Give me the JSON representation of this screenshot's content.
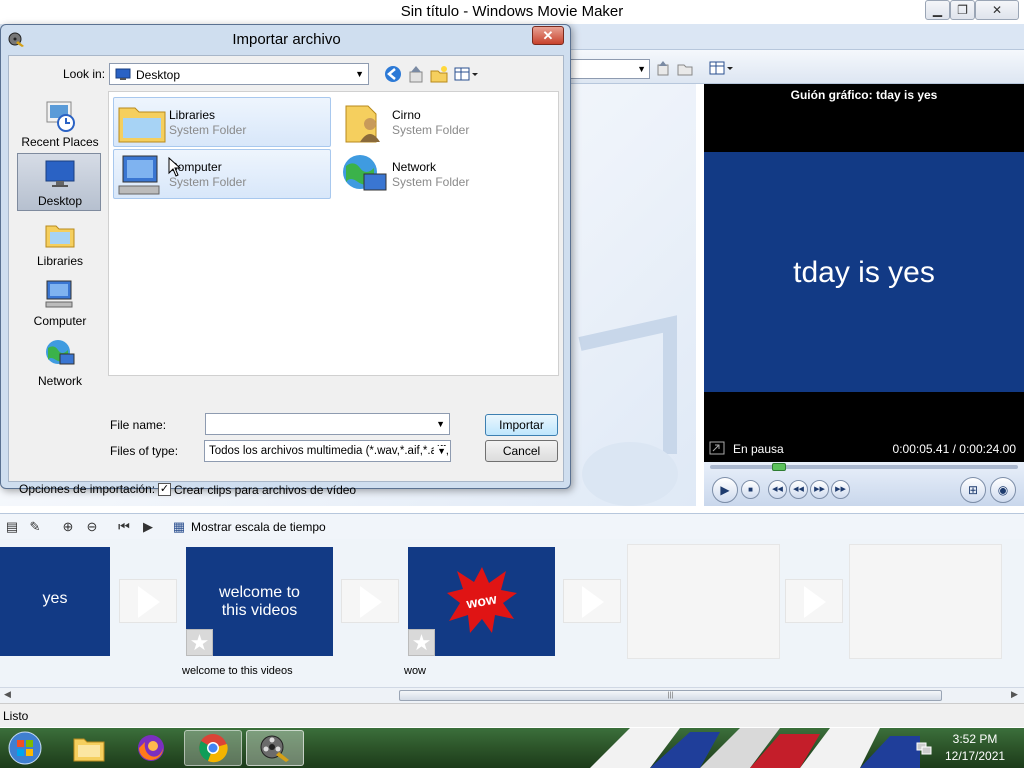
{
  "app": {
    "title": "Sin título - Windows Movie Maker",
    "window_buttons": [
      "minimize",
      "restore",
      "close"
    ]
  },
  "monitor": {
    "title": "Guión gráfico: tday is yes",
    "screen_text": "tday is yes",
    "status": "En pausa",
    "time": "0:00:05.41 / 0:00:24.00",
    "seek_fraction": 0.225
  },
  "timeline": {
    "toggle_label": "Mostrar escala de tiempo",
    "clips": [
      {
        "text": "yes",
        "caption": ""
      },
      {
        "text": "welcome to this videos",
        "caption": "welcome to this videos"
      },
      {
        "text": "wow",
        "caption": "wow"
      }
    ]
  },
  "status_bar": {
    "text": "Listo"
  },
  "dialog": {
    "title": "Importar archivo",
    "look_in_label": "Look in:",
    "look_in_value": "Desktop",
    "places": [
      {
        "label": "Recent Places",
        "icon": "recent-places-icon"
      },
      {
        "label": "Desktop",
        "icon": "desktop-icon",
        "selected": true
      },
      {
        "label": "Libraries",
        "icon": "libraries-icon"
      },
      {
        "label": "Computer",
        "icon": "computer-icon"
      },
      {
        "label": "Network",
        "icon": "network-icon"
      }
    ],
    "files": [
      {
        "name": "Libraries",
        "type": "System Folder"
      },
      {
        "name": "Cirno",
        "type": "System Folder"
      },
      {
        "name": "Computer",
        "type": "System Folder"
      },
      {
        "name": "Network",
        "type": "System Folder"
      }
    ],
    "file_name_label": "File name:",
    "file_name_value": "",
    "files_of_type_label": "Files of type:",
    "files_of_type_value": "Todos los archivos multimedia (*.wav,*.aif,*.aiff,",
    "import_button": "Importar",
    "cancel_button": "Cancel",
    "options_label": "Opciones de importación:",
    "create_clips_label": "Crear clips para archivos de vídeo",
    "create_clips_checked": true
  },
  "taskbar": {
    "apps": [
      "start-orb",
      "file-explorer",
      "firefox",
      "chrome",
      "movie-maker"
    ],
    "time": "3:52 PM",
    "date": "12/17/2021"
  },
  "colors": {
    "clip_blue": "#123a85",
    "dialog_frame": "#cfdeef",
    "close_red": "#c7422c"
  }
}
